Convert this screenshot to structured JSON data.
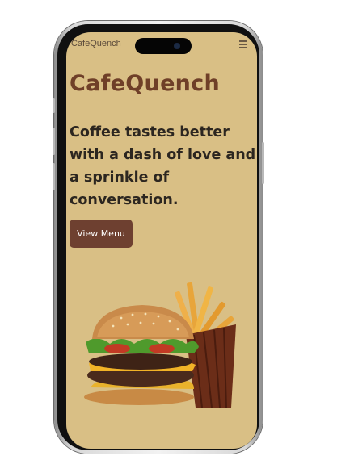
{
  "header": {
    "brand": "CafeQuench",
    "menu_icon": "hamburger-menu-icon"
  },
  "hero": {
    "title": "CafeQuench",
    "tagline": "Coffee tastes better with a dash of love and a sprinkle of conversation.",
    "cta_label": "View Menu",
    "image": "burger-and-fries-image"
  },
  "colors": {
    "background": "#d9bf85",
    "brand": "#6f3f28",
    "button": "#6e4030",
    "text": "#2c2620"
  }
}
